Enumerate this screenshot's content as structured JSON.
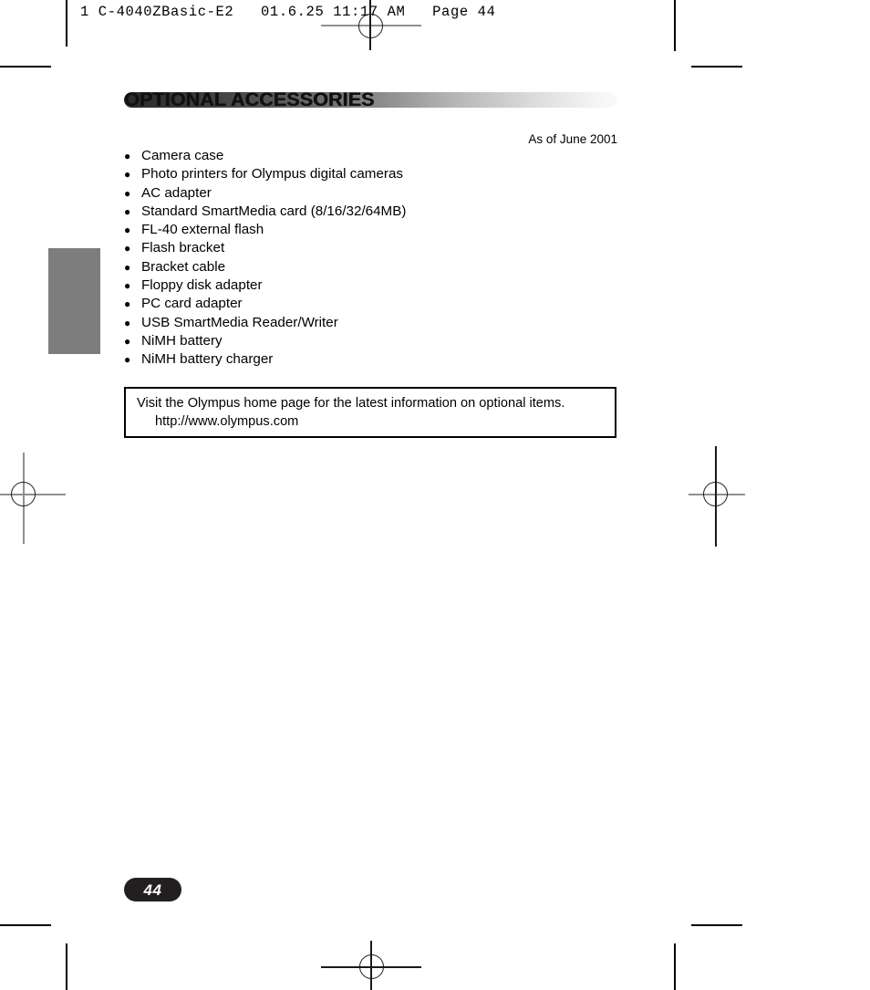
{
  "document": {
    "filestamp": "1 C-4040ZBasic-E2   01.6.25 11:17 AM   Page 44",
    "page_number": "44",
    "section_title": "OPTIONAL ACCESSORIES",
    "as_of": "As of June 2001"
  },
  "accessories": {
    "bullet_glyph": "●",
    "items": [
      {
        "label": "Camera case"
      },
      {
        "label": "Photo printers for Olympus digital cameras"
      },
      {
        "label": "AC adapter"
      },
      {
        "label": "Standard SmartMedia card (8/16/32/64MB)"
      },
      {
        "label": "FL-40 external flash"
      },
      {
        "label": "Flash bracket"
      },
      {
        "label": "Bracket cable"
      },
      {
        "label": "Floppy disk adapter"
      },
      {
        "label": "PC card adapter"
      },
      {
        "label": "USB SmartMedia Reader/Writer"
      },
      {
        "label": "NiMH battery"
      },
      {
        "label": "NiMH battery charger"
      }
    ]
  },
  "note": {
    "line1": "Visit the Olympus home page for the latest information on optional items.",
    "line2": "http://www.olympus.com"
  },
  "colors": {
    "thumb_tab": "#7d7d7d",
    "banner_dark": "#2b2b2b",
    "banner_light": "#fafafa",
    "page_pill": "#231f20",
    "note_border": "#000000",
    "text": "#000000"
  }
}
